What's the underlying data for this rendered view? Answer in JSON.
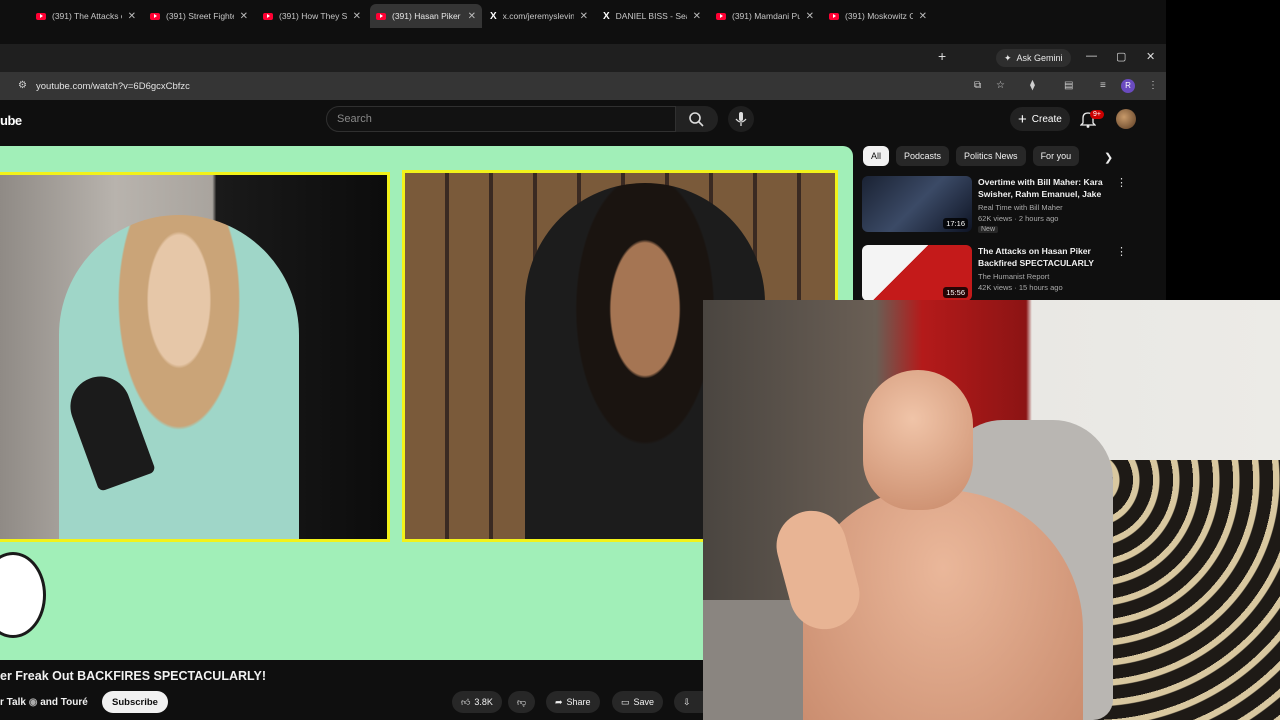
{
  "browser": {
    "tabs": [
      {
        "title": "(391) The Attacks o",
        "type": "youtube"
      },
      {
        "title": "(391) Street Fighter",
        "type": "youtube"
      },
      {
        "title": "(391) How They St",
        "type": "youtube"
      },
      {
        "title": "(391) Hasan Piker I",
        "type": "youtube",
        "active": true
      },
      {
        "title": "x.com/jeremyslevin",
        "type": "x"
      },
      {
        "title": "DANIEL BISS - Sear",
        "type": "x"
      },
      {
        "title": "(391) Mamdani Pu",
        "type": "youtube"
      },
      {
        "title": "(391) Moskowitz Cl",
        "type": "youtube"
      }
    ],
    "new_tab": "+",
    "gemini_label": "Ask Gemini",
    "url": "youtube.com/watch?v=6D6gcxCbfzc",
    "profile_initial": "R"
  },
  "youtube": {
    "logo": "ube",
    "search_placeholder": "Search",
    "create_label": "Create",
    "notifications_badge": "9+",
    "video": {
      "title": "er Freak Out BACKFIRES SPECTACULARLY!",
      "channel": "r Talk",
      "channel_collab": "and Touré",
      "subscribe_label": "Subscribe",
      "likes": "3.8K",
      "share_label": "Share",
      "save_label": "Save"
    },
    "chips": [
      "All",
      "Podcasts",
      "Politics News",
      "For you"
    ],
    "recommendations": [
      {
        "title": "Overtime with Bill Maher: Kara Swisher, Rahm Emanuel, Jake ...",
        "channel": "Real Time with Bill Maher",
        "meta": "62K views · 2 hours ago",
        "badge": "New",
        "duration": "17:16"
      },
      {
        "title": "The Attacks on Hasan Piker Backfired SPECTACULARLY",
        "channel": "The Humanist Report",
        "meta": "42K views · 15 hours ago",
        "duration": "15:56"
      }
    ]
  },
  "colors": {
    "video_bg": "#a1efb8",
    "frame_border": "#f2f21a",
    "yt_red": "#ff0033"
  }
}
